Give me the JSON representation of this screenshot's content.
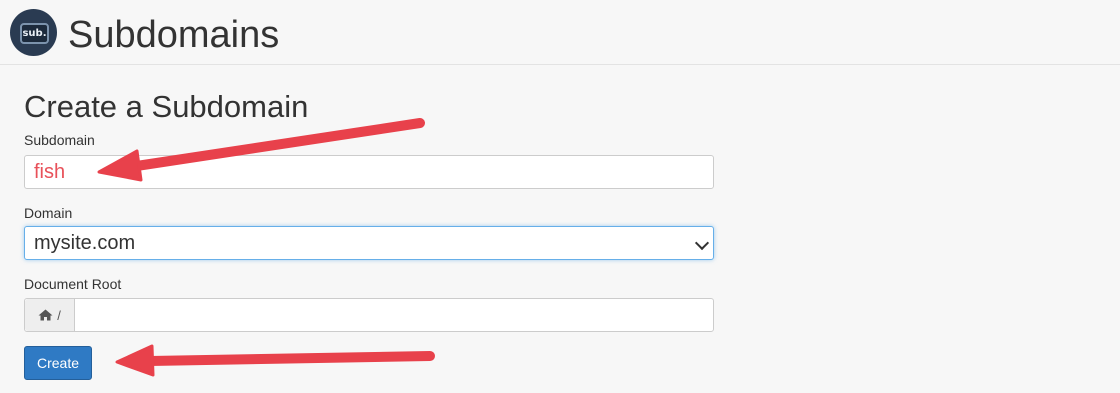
{
  "header": {
    "logo_text": "sub.",
    "title": "Subdomains"
  },
  "form": {
    "section_title": "Create a Subdomain",
    "subdomain_label": "Subdomain",
    "subdomain_value": "fish",
    "domain_label": "Domain",
    "domain_selected": "mysite.com",
    "docroot_label": "Document Root",
    "docroot_prefix": "/",
    "docroot_value": "",
    "create_label": "Create"
  },
  "icons": {
    "logo": "sub-logo-icon",
    "home": "home-icon",
    "dropdown": "chevron-down-icon",
    "annotation": "red-arrow-icon"
  },
  "colors": {
    "accent": "#2f7ac4",
    "annotation_arrow": "#e8414b",
    "subdomain_text": "#e8515a"
  }
}
